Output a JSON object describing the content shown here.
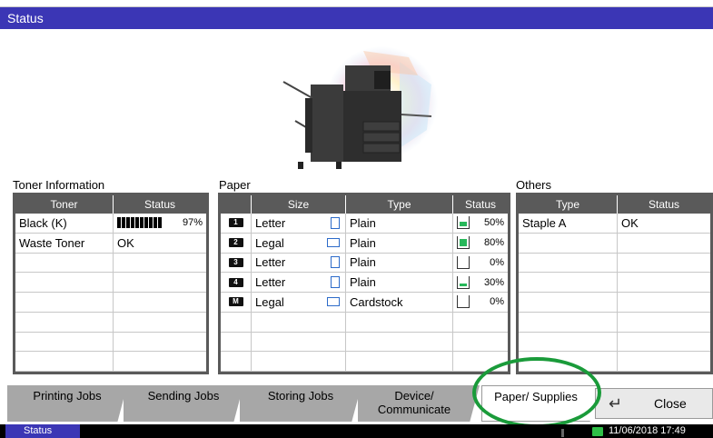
{
  "title": "Status",
  "toner": {
    "section_title": "Toner Information",
    "headers": [
      "Toner",
      "Status"
    ],
    "rows": [
      {
        "name": "Black (K)",
        "status": "",
        "level_pct": "97%",
        "level": 0.97
      },
      {
        "name": "Waste Toner",
        "status": "OK",
        "level_pct": "",
        "level": null
      },
      {
        "name": "",
        "status": ""
      },
      {
        "name": "",
        "status": ""
      },
      {
        "name": "",
        "status": ""
      },
      {
        "name": "",
        "status": ""
      },
      {
        "name": "",
        "status": ""
      },
      {
        "name": "",
        "status": ""
      }
    ]
  },
  "paper": {
    "section_title": "Paper",
    "headers": [
      "",
      "Size",
      "Type",
      "Status"
    ],
    "rows": [
      {
        "tray": "1",
        "size": "Letter",
        "orientation": "portrait",
        "type": "Plain",
        "status": "50%",
        "level": 0.5
      },
      {
        "tray": "2",
        "size": "Legal",
        "orientation": "landscape",
        "type": "Plain",
        "status": "80%",
        "level": 0.8
      },
      {
        "tray": "3",
        "size": "Letter",
        "orientation": "portrait",
        "type": "Plain",
        "status": "0%",
        "level": 0
      },
      {
        "tray": "4",
        "size": "Letter",
        "orientation": "portrait",
        "type": "Plain",
        "status": "30%",
        "level": 0.3
      },
      {
        "tray": "M",
        "size": "Legal",
        "orientation": "landscape",
        "type": "Cardstock",
        "status": "0%",
        "level": 0
      },
      {
        "tray": "",
        "size": "",
        "type": "",
        "status": ""
      },
      {
        "tray": "",
        "size": "",
        "type": "",
        "status": ""
      },
      {
        "tray": "",
        "size": "",
        "type": "",
        "status": ""
      }
    ]
  },
  "others": {
    "section_title": "Others",
    "headers": [
      "Type",
      "Status"
    ],
    "rows": [
      {
        "type": "Staple A",
        "status": "OK"
      },
      {
        "type": "",
        "status": ""
      },
      {
        "type": "",
        "status": ""
      },
      {
        "type": "",
        "status": ""
      },
      {
        "type": "",
        "status": ""
      },
      {
        "type": "",
        "status": ""
      },
      {
        "type": "",
        "status": ""
      },
      {
        "type": "",
        "status": ""
      }
    ]
  },
  "tabs": [
    {
      "label": "Printing Jobs",
      "selected": false
    },
    {
      "label": "Sending Jobs",
      "selected": false
    },
    {
      "label": "Storing Jobs",
      "selected": false
    },
    {
      "label": "Device/ Communicate",
      "selected": false
    },
    {
      "label": "Paper/ Supplies",
      "selected": true
    }
  ],
  "close_label": "Close",
  "status_tab": "Status",
  "datetime": "11/06/2018 17:49",
  "colors": {
    "titlebar": "#3b36b5",
    "level_fill": "#27b85a",
    "highlight": "#1a9b3a"
  }
}
